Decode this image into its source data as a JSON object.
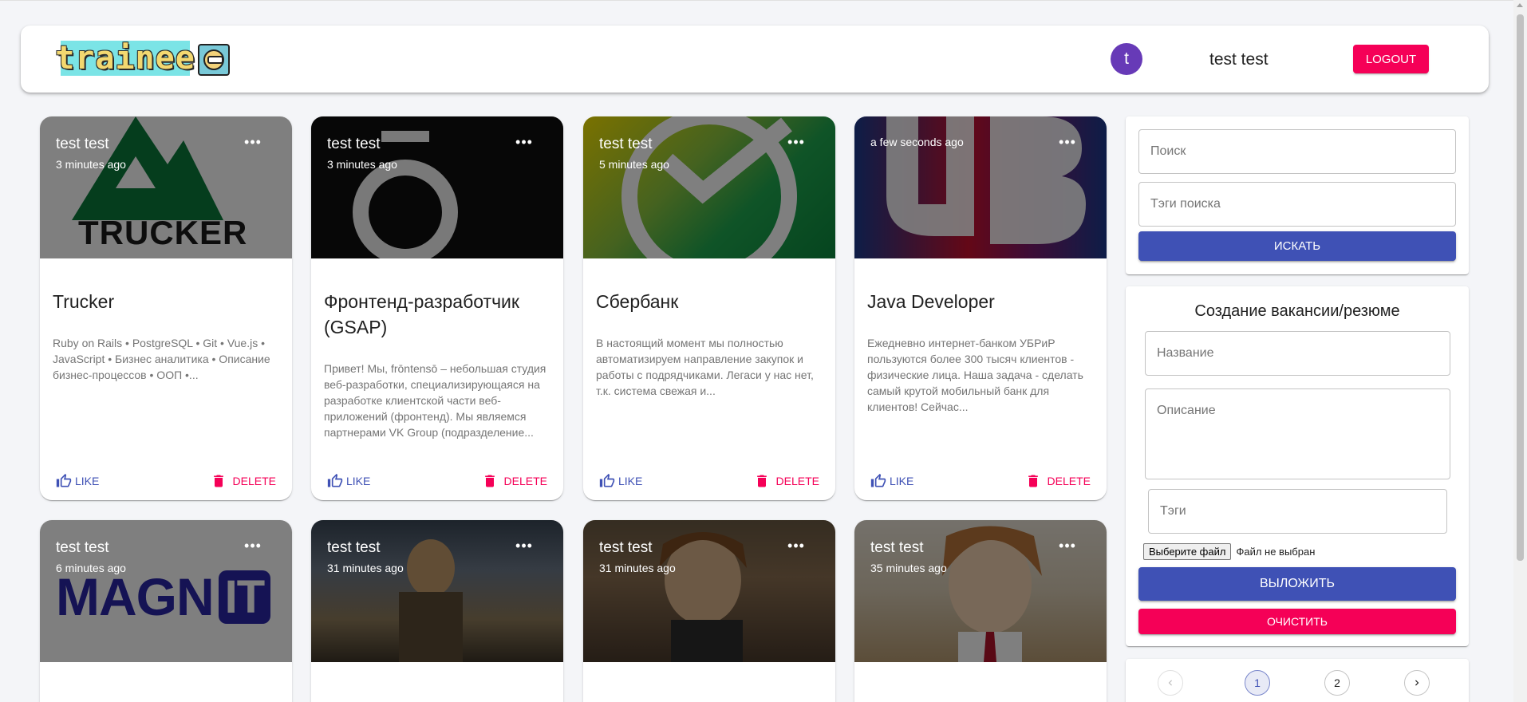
{
  "header": {
    "logo_text": "trainee",
    "avatar_letter": "t",
    "user_name": "test test",
    "logout_label": "Logout"
  },
  "cards": [
    {
      "author": "test test",
      "time": "3 minutes ago",
      "title": "Trucker",
      "description": "Ruby on Rails • PostgreSQL • Git • Vue.js • JavaScript • Бизнес аналитика • Описание бизнес-процессов • ООП •...",
      "like_label": "Like",
      "delete_label": "Delete",
      "logo_text": "TRUCKER"
    },
    {
      "author": "test test",
      "time": "3 minutes ago",
      "title": "Фронтенд-разработчик (GSAP)",
      "description": "Привет! Мы, frōntensō – небольшая студия веб-разработки, специализирующаяся на разработке клиентской части веб-приложений (фронтенд). Мы являемся партнерами VK Group (подразделение...",
      "like_label": "Like",
      "delete_label": "Delete"
    },
    {
      "author": "test test",
      "time": "5 minutes ago",
      "title": "Сбербанк",
      "description": "В настоящий момент мы полностью автоматизируем направление закупок и работы с подрядчиками. Легаси у нас нет, т.к. система свежая и...",
      "like_label": "Like",
      "delete_label": "Delete"
    },
    {
      "author": "",
      "time": "a few seconds ago",
      "title": "Java Developer",
      "description": "Ежедневно интернет-банком УБРиР пользуются более 300 тысяч клиентов - физические лица. Наша задача - сделать самый крутой мобильный банк для клиентов! Сейчас...",
      "like_label": "Like",
      "delete_label": "Delete"
    },
    {
      "author": "test test",
      "time": "6 minutes ago",
      "logo_text": "MAGN",
      "logo_text_2": "IT"
    },
    {
      "author": "test test",
      "time": "31 minutes ago"
    },
    {
      "author": "test test",
      "time": "31 minutes ago"
    },
    {
      "author": "test test",
      "time": "35 minutes ago"
    }
  ],
  "search": {
    "search_placeholder": "Поиск",
    "tags_placeholder": "Тэги поиска",
    "button_label": "Искать"
  },
  "form": {
    "title": "Создание вакансии/резюме",
    "name_placeholder": "Название",
    "description_placeholder": "Описание",
    "tags_placeholder": "Тэги",
    "file_button_label": "Выберите файл",
    "file_status": "Файл не выбран",
    "submit_label": "Выложить",
    "clear_label": "Очистить"
  },
  "pagination": {
    "pages": [
      "1",
      "2"
    ],
    "current_page": "1"
  },
  "colors": {
    "primary": "#3f51b5",
    "secondary": "#f50057",
    "avatar": "#673ab7"
  }
}
